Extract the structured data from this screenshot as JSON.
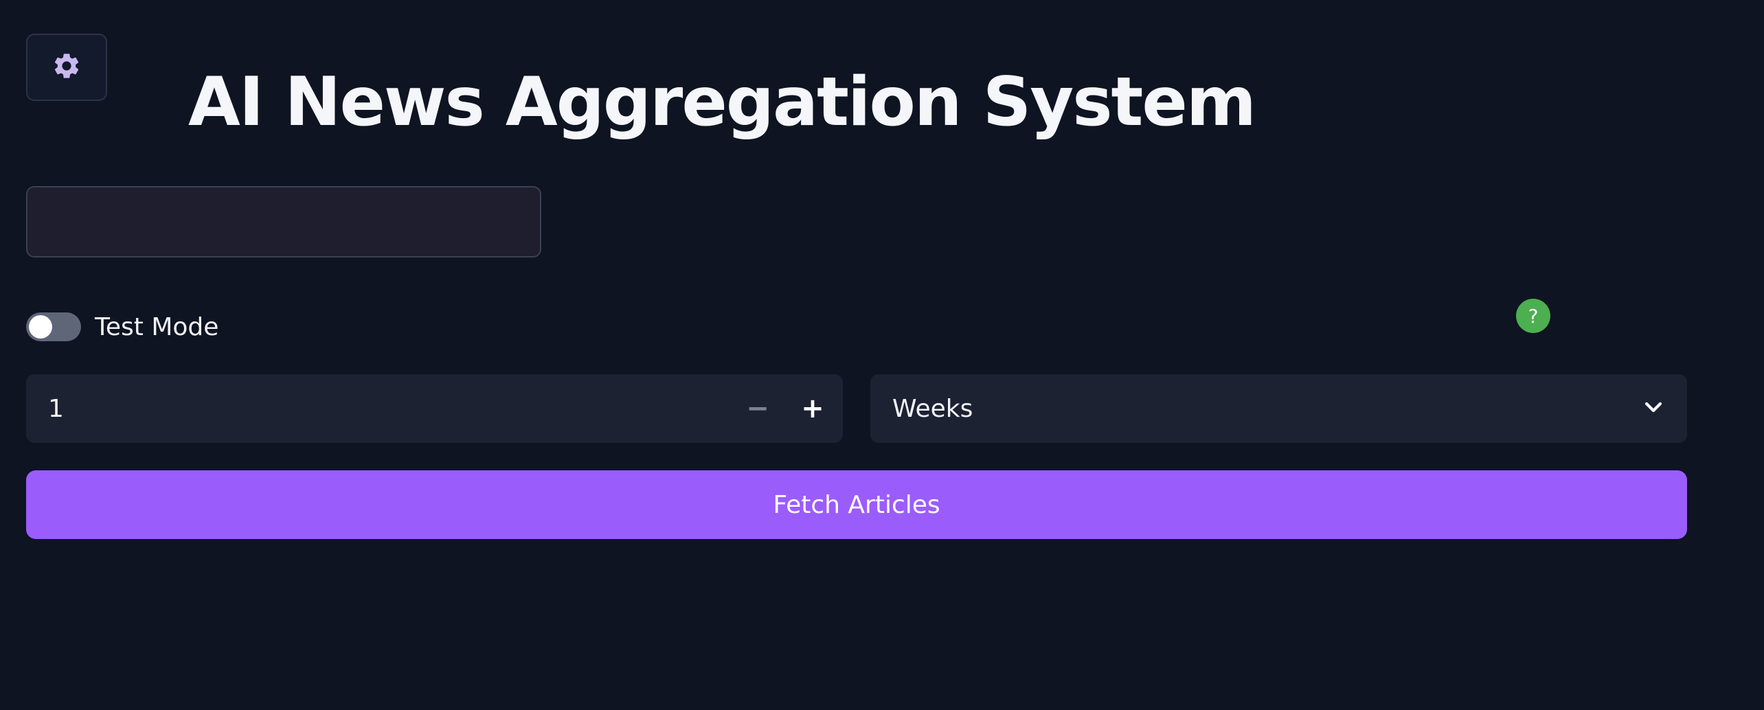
{
  "header": {
    "settings_icon": "gear-icon",
    "title": "AI News Aggregation System"
  },
  "form": {
    "text_input": {
      "value": "",
      "placeholder": ""
    },
    "test_mode": {
      "label": "Test Mode",
      "enabled": false
    },
    "help": {
      "icon": "help-icon",
      "glyph": "?"
    },
    "period_amount": {
      "value": "1",
      "minus_glyph": "−",
      "plus_glyph": "+"
    },
    "period_unit": {
      "selected": "Weeks",
      "icon": "chevron-down-icon"
    },
    "submit_label": "Fetch Articles"
  },
  "colors": {
    "background": "#0e1421",
    "accent": "#9b5cfc",
    "help": "#4caf50",
    "field": "#1c2232"
  }
}
